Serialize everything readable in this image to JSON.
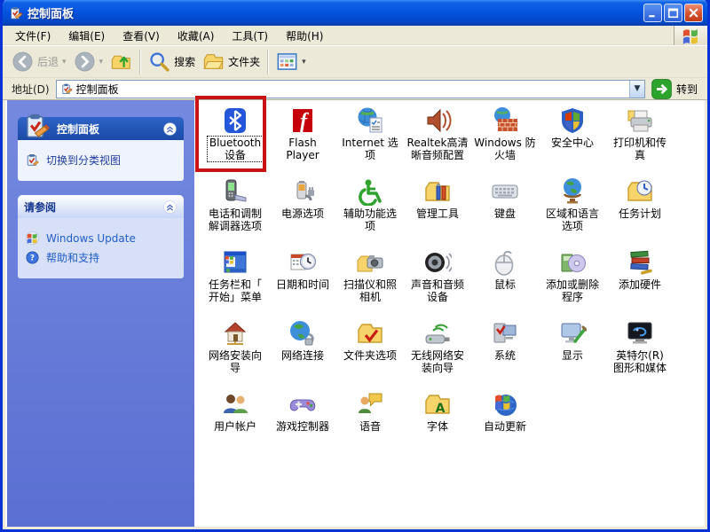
{
  "window": {
    "title": "控制面板",
    "icon": "control-panel"
  },
  "titlebar": {
    "buttons": [
      {
        "name": "minimize",
        "icon": "minimize"
      },
      {
        "name": "maximize",
        "icon": "maximize"
      },
      {
        "name": "close",
        "icon": "close"
      }
    ]
  },
  "menubar": {
    "items": [
      "文件(F)",
      "编辑(E)",
      "查看(V)",
      "收藏(A)",
      "工具(T)",
      "帮助(H)"
    ]
  },
  "toolbar": {
    "back_label": "后退",
    "search_label": "搜索",
    "folders_label": "文件夹"
  },
  "addressbar": {
    "label": "地址(D)",
    "value": "控制面板",
    "go_label": "转到"
  },
  "sidebar": {
    "panels": [
      {
        "title": "控制面板",
        "icon": "control-panel",
        "items": [
          {
            "label": "切换到分类视图",
            "icon": "switch-view"
          }
        ]
      },
      {
        "title": "请参阅",
        "items": [
          {
            "label": "Windows Update",
            "icon": "windows-update"
          },
          {
            "label": "帮助和支持",
            "icon": "help"
          }
        ]
      }
    ]
  },
  "grid": {
    "items": [
      {
        "label": "Bluetooth\n设备",
        "icon": "bluetooth",
        "selected": true,
        "highlighted": true
      },
      {
        "label": "Flash\nPlayer",
        "icon": "flash-player"
      },
      {
        "label": "Internet 选\n项",
        "icon": "internet-options"
      },
      {
        "label": "Realtek高清\n晰音频配置",
        "icon": "realtek-audio"
      },
      {
        "label": "Windows 防\n火墙",
        "icon": "windows-firewall"
      },
      {
        "label": "安全中心",
        "icon": "security-center"
      },
      {
        "label": "打印机和传\n真",
        "icon": "printers-faxes"
      },
      {
        "label": "电话和调制\n解调器选项",
        "icon": "phone-modem"
      },
      {
        "label": "电源选项",
        "icon": "power-options"
      },
      {
        "label": "辅助功能选\n项",
        "icon": "accessibility"
      },
      {
        "label": "管理工具",
        "icon": "admin-tools"
      },
      {
        "label": "键盘",
        "icon": "keyboard"
      },
      {
        "label": "区域和语言\n选项",
        "icon": "regional-language"
      },
      {
        "label": "任务计划",
        "icon": "scheduled-tasks"
      },
      {
        "label": "任务栏和「\n开始」菜单",
        "icon": "taskbar-startmenu"
      },
      {
        "label": "日期和时间",
        "icon": "date-time"
      },
      {
        "label": "扫描仪和照\n相机",
        "icon": "scanners-cameras"
      },
      {
        "label": "声音和音频\n设备",
        "icon": "sounds-audio"
      },
      {
        "label": "鼠标",
        "icon": "mouse"
      },
      {
        "label": "添加或删除\n程序",
        "icon": "add-remove-programs"
      },
      {
        "label": "添加硬件",
        "icon": "add-hardware"
      },
      {
        "label": "网络安装向\n导",
        "icon": "network-setup-wizard"
      },
      {
        "label": "网络连接",
        "icon": "network-connections"
      },
      {
        "label": "文件夹选项",
        "icon": "folder-options"
      },
      {
        "label": "无线网络安\n装向导",
        "icon": "wireless-network-wizard"
      },
      {
        "label": "系统",
        "icon": "system"
      },
      {
        "label": "显示",
        "icon": "display"
      },
      {
        "label": "英特尔(R)\n图形和媒体",
        "icon": "intel-graphics"
      },
      {
        "label": "用户帐户",
        "icon": "user-accounts"
      },
      {
        "label": "游戏控制器",
        "icon": "game-controllers"
      },
      {
        "label": "语音",
        "icon": "speech"
      },
      {
        "label": "字体",
        "icon": "fonts"
      },
      {
        "label": "自动更新",
        "icon": "automatic-updates"
      }
    ]
  },
  "colors": {
    "highlight_red": "#C81414",
    "titlebar_blue": "#0553E0",
    "sidebar_top": "#7489DE",
    "sidebar_bottom": "#5A6FD2",
    "chrome": "#ECE9D8",
    "link_blue": "#215DC6"
  }
}
